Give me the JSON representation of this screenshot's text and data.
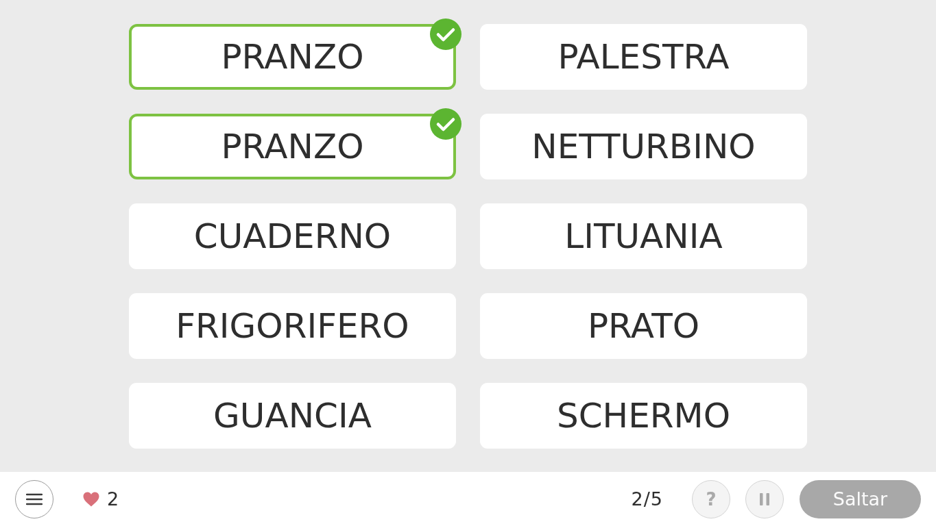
{
  "cards": [
    {
      "word": "PRANZO",
      "selected": true
    },
    {
      "word": "PALESTRA",
      "selected": false
    },
    {
      "word": "PRANZO",
      "selected": true
    },
    {
      "word": "NETTURBINO",
      "selected": false
    },
    {
      "word": "CUADERNO",
      "selected": false
    },
    {
      "word": "LITUANIA",
      "selected": false
    },
    {
      "word": "FRIGORIFERO",
      "selected": false
    },
    {
      "word": "PRATO",
      "selected": false
    },
    {
      "word": "GUANCIA",
      "selected": false
    },
    {
      "word": "SCHERMO",
      "selected": false
    }
  ],
  "bottom_bar": {
    "lives": "2",
    "progress": "2/5",
    "help_button": "?",
    "skip_button": {
      "label": "Saltar",
      "disabled": true
    }
  }
}
